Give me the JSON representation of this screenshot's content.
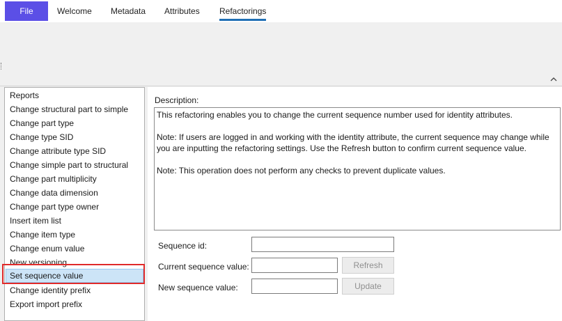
{
  "ribbon": {
    "file_label": "File",
    "tabs": [
      {
        "label": "Welcome"
      },
      {
        "label": "Metadata"
      },
      {
        "label": "Attributes"
      },
      {
        "label": "Refactorings"
      }
    ],
    "active_tab": "Refactorings",
    "accent_color": "#5b4fe6"
  },
  "refactorings": {
    "items": [
      {
        "label": "Reports"
      },
      {
        "label": "Change structural part to simple"
      },
      {
        "label": "Change part type"
      },
      {
        "label": "Change type SID"
      },
      {
        "label": "Change attribute type SID"
      },
      {
        "label": "Change simple part to structural"
      },
      {
        "label": "Change part multiplicity"
      },
      {
        "label": "Change data dimension"
      },
      {
        "label": "Change part type owner"
      },
      {
        "label": "Insert item list"
      },
      {
        "label": "Change item type"
      },
      {
        "label": "Change enum value"
      },
      {
        "label": "New versioning"
      },
      {
        "label": "Set sequence value"
      },
      {
        "label": "Change identity prefix"
      },
      {
        "label": "Export import prefix"
      }
    ],
    "selected": "Set sequence value",
    "highlight_color": "#e02a2a"
  },
  "detail": {
    "description_label": "Description:",
    "description_paragraphs": [
      "This refactoring enables you to change the current sequence number used for identity attributes.",
      "Note: If users are logged in and working with the identity attribute, the current sequence may change while you are inputting the refactoring settings. Use the Refresh button to confirm current sequence value.",
      "Note: This operation does not perform any checks to prevent duplicate values."
    ],
    "sequence_id_label": "Sequence id:",
    "sequence_id_value": "",
    "current_value_label": "Current sequence value:",
    "current_value": "",
    "refresh_label": "Refresh",
    "new_value_label": "New sequence value:",
    "new_value": "",
    "update_label": "Update"
  }
}
